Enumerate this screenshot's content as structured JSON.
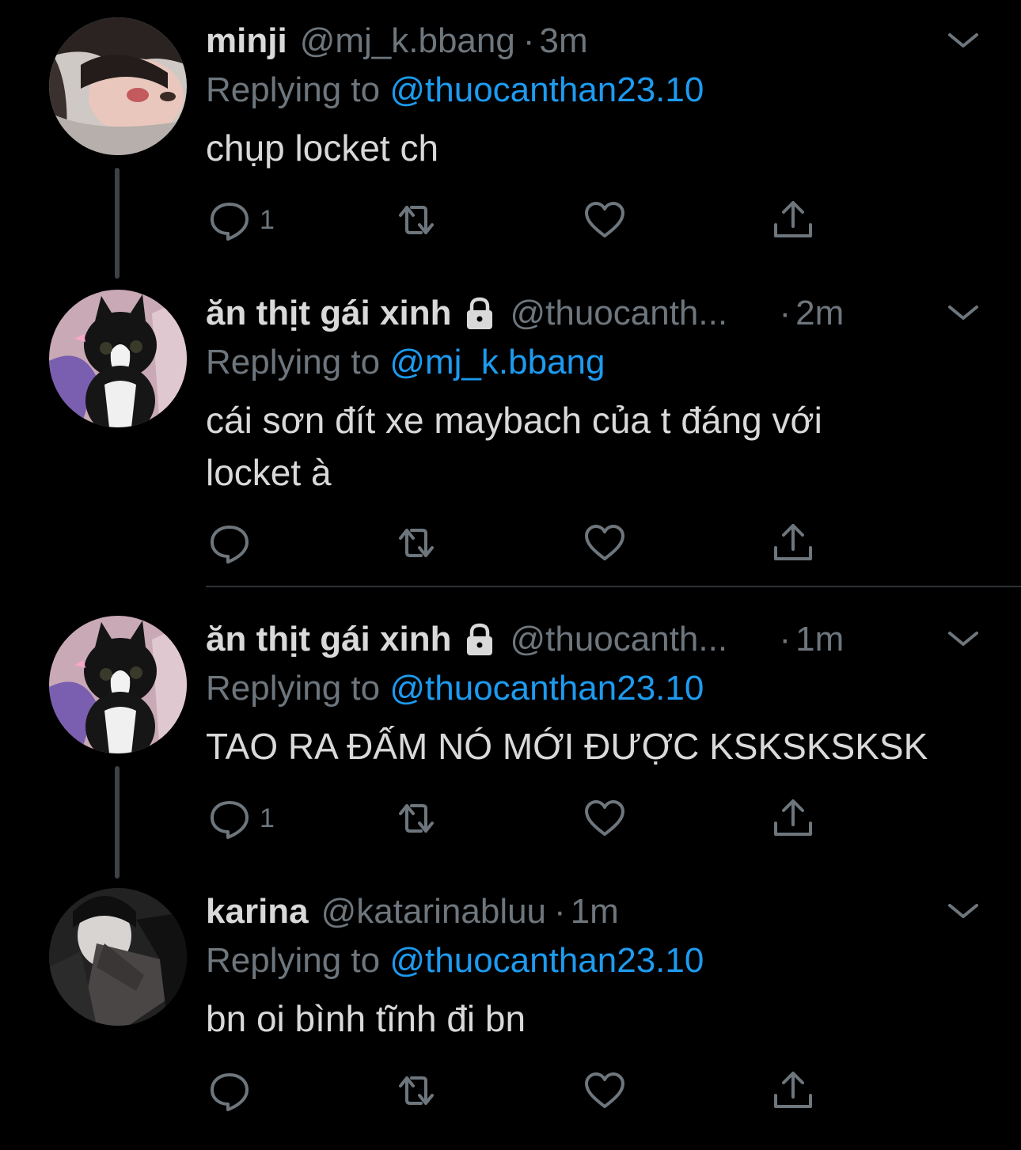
{
  "colors": {
    "background": "#000000",
    "text": "#d9d9d9",
    "muted": "#6e767d",
    "mention": "#1d9bf0",
    "thread_line": "#3d4248"
  },
  "tweets": [
    {
      "name": "minji",
      "handle": "@mj_k.bbang",
      "dot": "·",
      "time": "3m",
      "replying_label": "Replying to ",
      "replying_to": "@thuocanthan23.10",
      "text": "chụp locket ch",
      "reply_count": "1",
      "locked": false,
      "avatar": "minji-avatar"
    },
    {
      "name": "ăn thịt gái xinh",
      "handle": "@thuocanth...",
      "dot": "·",
      "time": "2m",
      "replying_label": "Replying to ",
      "replying_to": "@mj_k.bbang",
      "text": "cái sơn đít xe maybach của t đáng với locket à",
      "reply_count": "",
      "locked": true,
      "avatar": "kitten-avatar"
    },
    {
      "name": "ăn thịt gái xinh",
      "handle": "@thuocanth...",
      "dot": "·",
      "time": "1m",
      "replying_label": "Replying to ",
      "replying_to": "@thuocanthan23.10",
      "text": "TAO RA ĐẤM NÓ MỚI ĐƯỢC KSKSKSKSK",
      "reply_count": "1",
      "locked": true,
      "avatar": "kitten-avatar"
    },
    {
      "name": "karina",
      "handle": "@katarinabluu",
      "dot": "·",
      "time": "1m",
      "replying_label": "Replying to ",
      "replying_to": "@thuocanthan23.10",
      "text": "bn oi bình tĩnh đi bn",
      "reply_count": "",
      "locked": false,
      "avatar": "karina-avatar"
    }
  ],
  "icons": {
    "reply": "reply-icon",
    "retweet": "retweet-icon",
    "like": "heart-icon",
    "share": "share-icon",
    "more": "chevron-down-icon",
    "lock": "lock-icon"
  }
}
